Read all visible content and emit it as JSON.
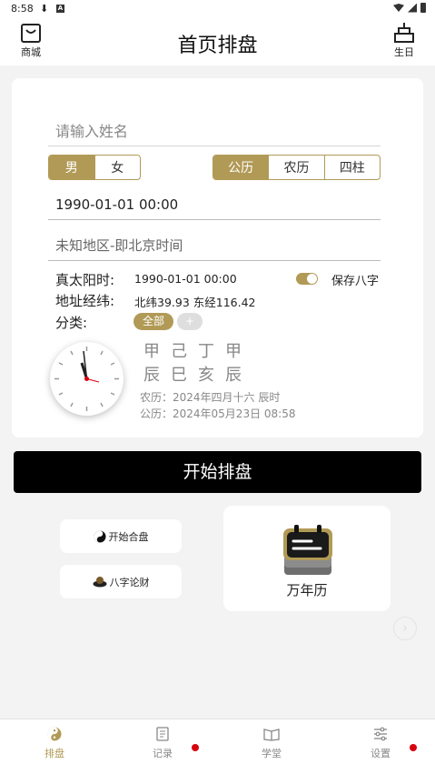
{
  "status_bar": {
    "time": "8:58"
  },
  "header": {
    "title": "首页排盘",
    "left_label": "商城",
    "right_label": "生日"
  },
  "form": {
    "name_placeholder": "请输入姓名",
    "gender": {
      "options": [
        "男",
        "女"
      ],
      "selected": "男"
    },
    "calendar": {
      "options": [
        "公历",
        "农历",
        "四柱"
      ],
      "selected": "公历"
    },
    "date_value": "1990-01-01 00:00",
    "location_value": "未知地区-即北京时间"
  },
  "info": {
    "solar_time_label": "真太阳时:",
    "solar_time_value": "1990-01-01 00:00",
    "save_bazi_label": "保存八字",
    "save_bazi_on": true,
    "coords_label": "地址经纬:",
    "coords_value": "北纬39.93 东经116.42",
    "category_label": "分类:",
    "category_chip": "全部",
    "category_add": "+"
  },
  "pillars": {
    "stems": "甲己丁甲",
    "branches": "辰巳亥辰",
    "lunar": "农历：2024年四月十六 辰时",
    "solar": "公历：2024年05月23日 08:58"
  },
  "actions": {
    "start_button": "开始排盘",
    "hepan_label": "开始合盘",
    "lucai_label": "八字论财",
    "calendar_label": "万年历"
  },
  "tabs": [
    {
      "label": "排盘",
      "active": true
    },
    {
      "label": "记录",
      "active": false
    },
    {
      "label": "学堂",
      "active": false
    },
    {
      "label": "设置",
      "active": false
    }
  ],
  "colors": {
    "accent": "#b19a56",
    "primary_button": "#000000",
    "notification_dot": "#d7000f"
  }
}
